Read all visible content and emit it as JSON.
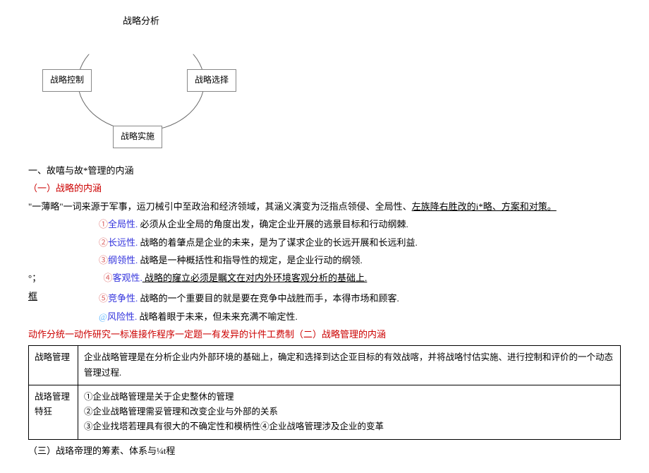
{
  "diagram": {
    "title": "战略分析",
    "nodeTop": "战略分析",
    "nodeLeft": "战略控制",
    "nodeRight": "战略选择",
    "nodeBottom": "战略实施"
  },
  "h1": "一、故嘻与故*管理的内涵",
  "h2a": "（一）战略的内涵",
  "para1a": "\"一薄略\"一词来源于军事，运刀械引中至政治和经济领域，其涵义演变为泛指点领侵、全局性、",
  "para1b": "左族降右胜改的i*略、方案和对策。",
  "attr1_num": "①",
  "attr1_label": "全局性.",
  "attr1_text": " 必须从企业全局的角度出发，确定企业开展的逃景目标和行动纲棘.",
  "attr2_num": "②",
  "attr2_label": "长远性.",
  "attr2_text": " 战略的着肇点是企业的未来，是为了谋求企业的长远开展和长远利益.",
  "attr3_num": "③",
  "attr3_label": "纲领性.",
  "attr3_text": " 战略是一种概括性和指导性的规定，是企业行动的纲领.",
  "side_deg": "°；",
  "attr4_num": "④",
  "attr4_label": "客观性.",
  "attr4_text": " 战略的窿立必须是瞩文在对内外环境客观分析的基础上.",
  "side_kuang": "框",
  "attr5_num": "⑤",
  "attr5_label": "竞争性.",
  "attr5_text": " 战略的一个重要目的就是要在竞争中战胜而手，本得市场和顾客.",
  "attr6_num": "@",
  "attr6_label": "风险性.",
  "attr6_text": " 战略着眼于未来，但未来充满不喻定性.",
  "redline": "动作分统一动作研究一标准接作程序一定题一有发异的计件工费制",
  "h2b": "（二）战略管理的内涵",
  "row1_label": "战略管理",
  "row1_text": "企业战略管理是在分析企业内外部环境的基础上，确定和选择到达企亚目标的有效战喀，并将战咯忖估实施、进行控制和评价的一个动态管理过程.",
  "row2_label": "战珞管理特狂",
  "row2_line1": "①企业战略管理是关于企史整休的管理",
  "row2_line2": "②企业战略管理需妥管理和改变企业与外部的关系",
  "row2_line3": "③企业找塔若理具有很大的不确定性和模柄性④企业战咯管理涉及企业的变革",
  "h2c": "（三）战珞帝理的筹素、体系与¼t程"
}
